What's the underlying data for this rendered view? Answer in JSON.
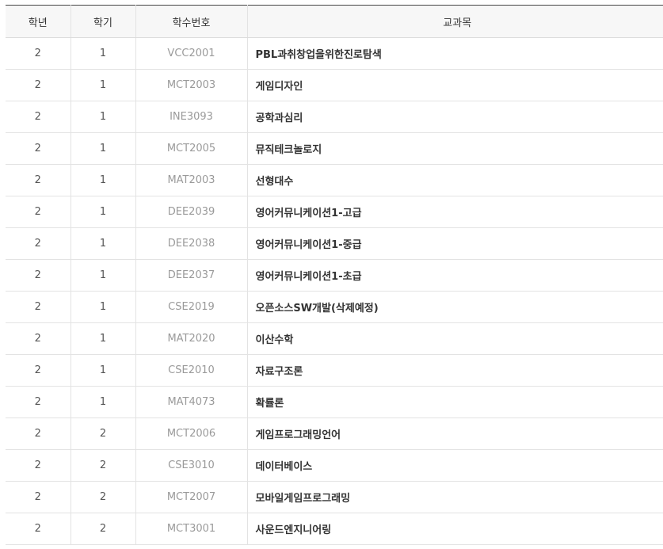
{
  "table": {
    "headers": {
      "grade": "학년",
      "semester": "학기",
      "code": "학수번호",
      "name": "교과목"
    },
    "rows": [
      {
        "grade": "2",
        "semester": "1",
        "code": "VCC2001",
        "name": "PBL과취창업을위한진로탐색"
      },
      {
        "grade": "2",
        "semester": "1",
        "code": "MCT2003",
        "name": "게임디자인"
      },
      {
        "grade": "2",
        "semester": "1",
        "code": "INE3093",
        "name": "공학과심리"
      },
      {
        "grade": "2",
        "semester": "1",
        "code": "MCT2005",
        "name": "뮤직테크놀로지"
      },
      {
        "grade": "2",
        "semester": "1",
        "code": "MAT2003",
        "name": "선형대수"
      },
      {
        "grade": "2",
        "semester": "1",
        "code": "DEE2039",
        "name": "영어커뮤니케이션1-고급"
      },
      {
        "grade": "2",
        "semester": "1",
        "code": "DEE2038",
        "name": "영어커뮤니케이션1-중급"
      },
      {
        "grade": "2",
        "semester": "1",
        "code": "DEE2037",
        "name": "영어커뮤니케이션1-초급"
      },
      {
        "grade": "2",
        "semester": "1",
        "code": "CSE2019",
        "name": "오픈소스SW개발(삭제예정)"
      },
      {
        "grade": "2",
        "semester": "1",
        "code": "MAT2020",
        "name": "이산수학"
      },
      {
        "grade": "2",
        "semester": "1",
        "code": "CSE2010",
        "name": "자료구조론"
      },
      {
        "grade": "2",
        "semester": "1",
        "code": "MAT4073",
        "name": "확률론"
      },
      {
        "grade": "2",
        "semester": "2",
        "code": "MCT2006",
        "name": "게임프로그래밍언어"
      },
      {
        "grade": "2",
        "semester": "2",
        "code": "CSE3010",
        "name": "데이터베이스"
      },
      {
        "grade": "2",
        "semester": "2",
        "code": "MCT2007",
        "name": "모바일게임프로그래밍"
      },
      {
        "grade": "2",
        "semester": "2",
        "code": "MCT3001",
        "name": "사운드엔지니어링"
      }
    ]
  }
}
